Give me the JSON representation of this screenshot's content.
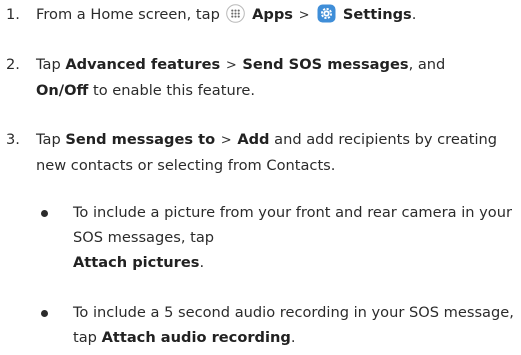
{
  "steps": [
    {
      "number": "1.",
      "parts": {
        "t1": "From a Home screen, tap",
        "apps": "Apps",
        "sep": ">",
        "settings": "Settings",
        "end": "."
      }
    },
    {
      "number": "2.",
      "parts": {
        "t1": "Tap",
        "advanced": "Advanced features",
        "sep": ">",
        "sos": "Send SOS messages",
        "t2": ", and",
        "onoff": "On/Off",
        "t3": "to enable this feature."
      }
    },
    {
      "number": "3.",
      "parts": {
        "t1": "Tap",
        "sendto": "Send messages to",
        "sep": ">",
        "add": "Add",
        "t2": "and add recipients by creating new contacts or selecting from Contacts."
      }
    }
  ],
  "bullets": [
    {
      "t1": "To include a picture from your front and rear camera in your SOS messages, tap",
      "action": "Attach pictures",
      "end": "."
    },
    {
      "t1": "To include a 5 second audio recording in your SOS message, tap",
      "action": "Attach audio recording",
      "end": "."
    }
  ],
  "icons": {
    "apps_icon": "apps-grid-icon",
    "settings_icon": "settings-gear-icon",
    "settings_color": "#3f8ed8"
  }
}
